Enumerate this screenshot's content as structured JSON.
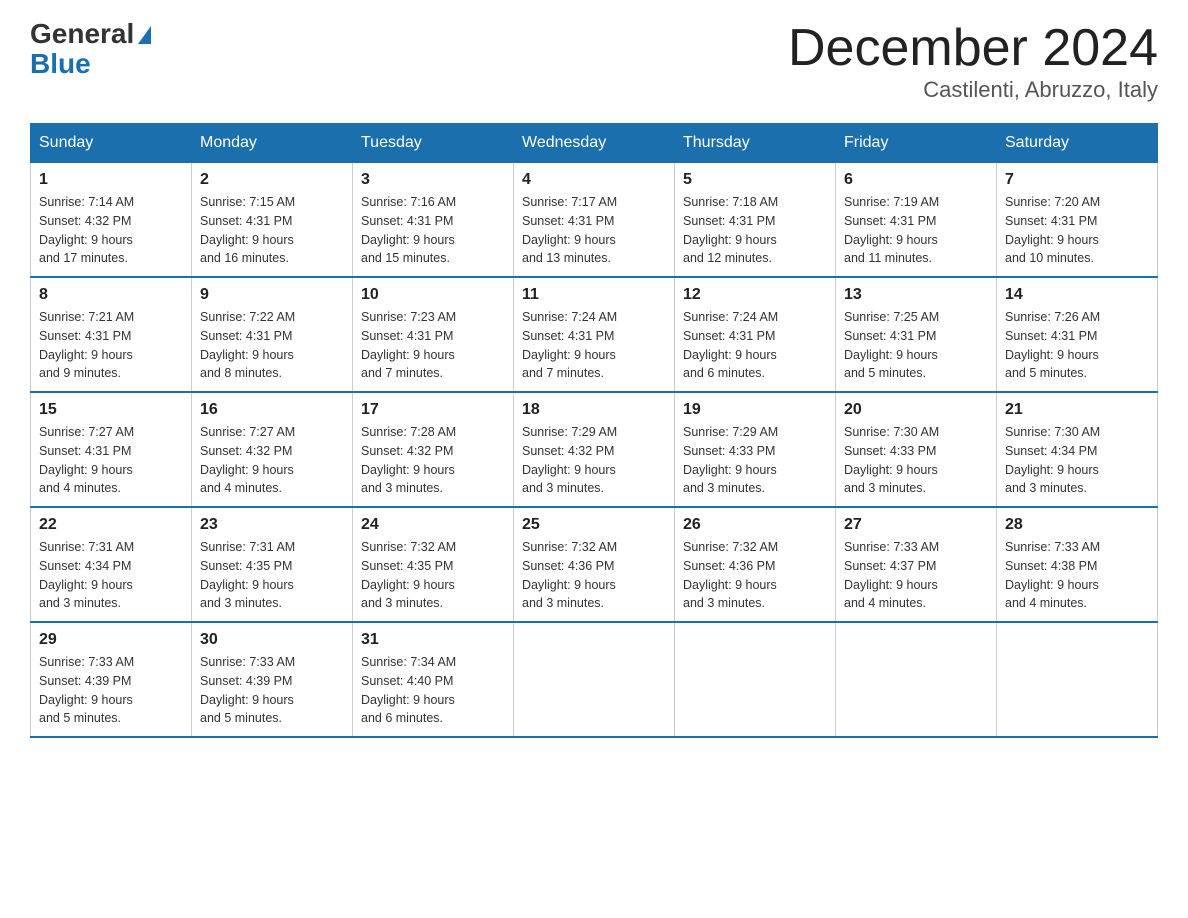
{
  "logo": {
    "general": "General",
    "blue": "Blue"
  },
  "header": {
    "month": "December 2024",
    "location": "Castilenti, Abruzzo, Italy"
  },
  "weekdays": [
    "Sunday",
    "Monday",
    "Tuesday",
    "Wednesday",
    "Thursday",
    "Friday",
    "Saturday"
  ],
  "weeks": [
    [
      {
        "day": "1",
        "sunrise": "7:14 AM",
        "sunset": "4:32 PM",
        "daylight": "9 hours and 17 minutes."
      },
      {
        "day": "2",
        "sunrise": "7:15 AM",
        "sunset": "4:31 PM",
        "daylight": "9 hours and 16 minutes."
      },
      {
        "day": "3",
        "sunrise": "7:16 AM",
        "sunset": "4:31 PM",
        "daylight": "9 hours and 15 minutes."
      },
      {
        "day": "4",
        "sunrise": "7:17 AM",
        "sunset": "4:31 PM",
        "daylight": "9 hours and 13 minutes."
      },
      {
        "day": "5",
        "sunrise": "7:18 AM",
        "sunset": "4:31 PM",
        "daylight": "9 hours and 12 minutes."
      },
      {
        "day": "6",
        "sunrise": "7:19 AM",
        "sunset": "4:31 PM",
        "daylight": "9 hours and 11 minutes."
      },
      {
        "day": "7",
        "sunrise": "7:20 AM",
        "sunset": "4:31 PM",
        "daylight": "9 hours and 10 minutes."
      }
    ],
    [
      {
        "day": "8",
        "sunrise": "7:21 AM",
        "sunset": "4:31 PM",
        "daylight": "9 hours and 9 minutes."
      },
      {
        "day": "9",
        "sunrise": "7:22 AM",
        "sunset": "4:31 PM",
        "daylight": "9 hours and 8 minutes."
      },
      {
        "day": "10",
        "sunrise": "7:23 AM",
        "sunset": "4:31 PM",
        "daylight": "9 hours and 7 minutes."
      },
      {
        "day": "11",
        "sunrise": "7:24 AM",
        "sunset": "4:31 PM",
        "daylight": "9 hours and 7 minutes."
      },
      {
        "day": "12",
        "sunrise": "7:24 AM",
        "sunset": "4:31 PM",
        "daylight": "9 hours and 6 minutes."
      },
      {
        "day": "13",
        "sunrise": "7:25 AM",
        "sunset": "4:31 PM",
        "daylight": "9 hours and 5 minutes."
      },
      {
        "day": "14",
        "sunrise": "7:26 AM",
        "sunset": "4:31 PM",
        "daylight": "9 hours and 5 minutes."
      }
    ],
    [
      {
        "day": "15",
        "sunrise": "7:27 AM",
        "sunset": "4:31 PM",
        "daylight": "9 hours and 4 minutes."
      },
      {
        "day": "16",
        "sunrise": "7:27 AM",
        "sunset": "4:32 PM",
        "daylight": "9 hours and 4 minutes."
      },
      {
        "day": "17",
        "sunrise": "7:28 AM",
        "sunset": "4:32 PM",
        "daylight": "9 hours and 3 minutes."
      },
      {
        "day": "18",
        "sunrise": "7:29 AM",
        "sunset": "4:32 PM",
        "daylight": "9 hours and 3 minutes."
      },
      {
        "day": "19",
        "sunrise": "7:29 AM",
        "sunset": "4:33 PM",
        "daylight": "9 hours and 3 minutes."
      },
      {
        "day": "20",
        "sunrise": "7:30 AM",
        "sunset": "4:33 PM",
        "daylight": "9 hours and 3 minutes."
      },
      {
        "day": "21",
        "sunrise": "7:30 AM",
        "sunset": "4:34 PM",
        "daylight": "9 hours and 3 minutes."
      }
    ],
    [
      {
        "day": "22",
        "sunrise": "7:31 AM",
        "sunset": "4:34 PM",
        "daylight": "9 hours and 3 minutes."
      },
      {
        "day": "23",
        "sunrise": "7:31 AM",
        "sunset": "4:35 PM",
        "daylight": "9 hours and 3 minutes."
      },
      {
        "day": "24",
        "sunrise": "7:32 AM",
        "sunset": "4:35 PM",
        "daylight": "9 hours and 3 minutes."
      },
      {
        "day": "25",
        "sunrise": "7:32 AM",
        "sunset": "4:36 PM",
        "daylight": "9 hours and 3 minutes."
      },
      {
        "day": "26",
        "sunrise": "7:32 AM",
        "sunset": "4:36 PM",
        "daylight": "9 hours and 3 minutes."
      },
      {
        "day": "27",
        "sunrise": "7:33 AM",
        "sunset": "4:37 PM",
        "daylight": "9 hours and 4 minutes."
      },
      {
        "day": "28",
        "sunrise": "7:33 AM",
        "sunset": "4:38 PM",
        "daylight": "9 hours and 4 minutes."
      }
    ],
    [
      {
        "day": "29",
        "sunrise": "7:33 AM",
        "sunset": "4:39 PM",
        "daylight": "9 hours and 5 minutes."
      },
      {
        "day": "30",
        "sunrise": "7:33 AM",
        "sunset": "4:39 PM",
        "daylight": "9 hours and 5 minutes."
      },
      {
        "day": "31",
        "sunrise": "7:34 AM",
        "sunset": "4:40 PM",
        "daylight": "9 hours and 6 minutes."
      },
      null,
      null,
      null,
      null
    ]
  ],
  "labels": {
    "sunrise": "Sunrise:",
    "sunset": "Sunset:",
    "daylight": "Daylight:"
  }
}
